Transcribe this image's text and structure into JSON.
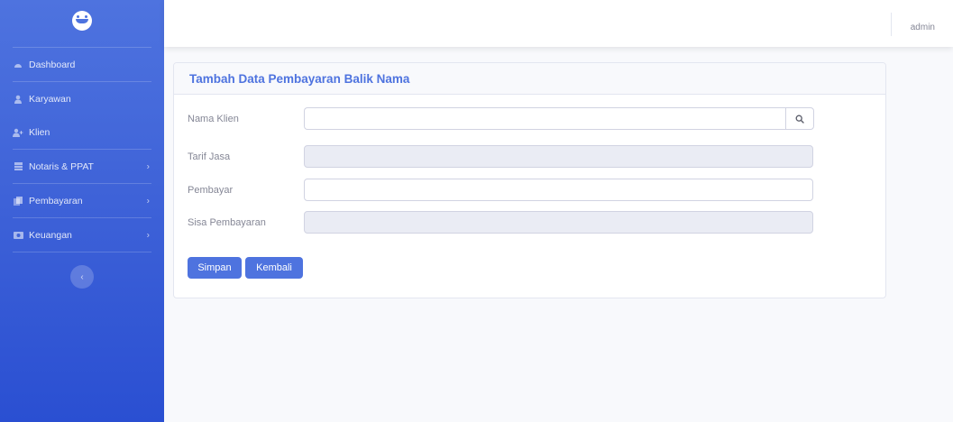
{
  "sidebar": {
    "brand_icon": "smiley-face-icon",
    "items": [
      {
        "label": "Dashboard",
        "icon": "tachometer-icon",
        "has_submenu": false
      },
      {
        "label": "Karyawan",
        "icon": "user-icon",
        "has_submenu": false
      },
      {
        "label": "Klien",
        "icon": "user-plus-icon",
        "has_submenu": false
      },
      {
        "label": "Notaris & PPAT",
        "icon": "table-icon",
        "has_submenu": true
      },
      {
        "label": "Pembayaran",
        "icon": "copy-icon",
        "has_submenu": true
      },
      {
        "label": "Keuangan",
        "icon": "money-icon",
        "has_submenu": true
      }
    ],
    "toggle_icon": "chevron-left-icon",
    "colors": {
      "accent": "#4e73df",
      "gradient_end": "#224abe"
    }
  },
  "topbar": {
    "user_name": "admin"
  },
  "card": {
    "title": "Tambah Data Pembayaran Balik Nama"
  },
  "form": {
    "nama_klien": {
      "label": "Nama Klien",
      "value": "",
      "search_icon": "search-icon"
    },
    "tarif_jasa": {
      "label": "Tarif Jasa",
      "value": "",
      "disabled": true
    },
    "pembayar": {
      "label": "Pembayar",
      "value": ""
    },
    "sisa_pembayaran": {
      "label": "Sisa Pembayaran",
      "value": "",
      "disabled": true
    }
  },
  "buttons": {
    "save": "Simpan",
    "back": "Kembali"
  }
}
